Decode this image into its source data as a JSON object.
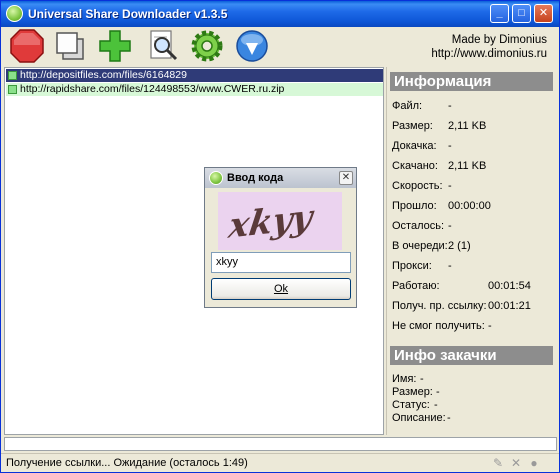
{
  "window": {
    "title": "Universal Share Downloader v1.3.5"
  },
  "title_buttons": {
    "minimize": "_",
    "maximize": "□",
    "close": "✕"
  },
  "toolbar": {
    "icons": [
      "stop-icon",
      "copy-icon",
      "add-icon",
      "search-icon",
      "gear-icon",
      "info-icon"
    ],
    "credits_line1": "Made by Dimonius",
    "credits_line2": "http://www.dimonius.ru"
  },
  "downloads": [
    {
      "url": "http://depositfiles.com/files/6164829",
      "selected": true
    },
    {
      "url": "http://rapidshare.com/files/124498553/www.CWER.ru.zip",
      "selected": false
    }
  ],
  "info": {
    "header": "Информация",
    "rows": [
      {
        "label": "Файл:",
        "value": "-"
      },
      {
        "label": "Размер:",
        "value": "2,11 KB"
      },
      {
        "label": "Докачка:",
        "value": "-"
      },
      {
        "label": "Скачано:",
        "value": "2,11 KB"
      },
      {
        "label": "Скорость:",
        "value": "-"
      },
      {
        "label": "Прошло:",
        "value": "00:00:00"
      },
      {
        "label": "Осталось:",
        "value": "-"
      },
      {
        "label": "В очереди:",
        "value": "2 (1)"
      },
      {
        "label": "Прокси:",
        "value": "-"
      },
      {
        "label": "Работаю:",
        "value": "00:01:54"
      },
      {
        "label": "Получ. пр. ссылку:",
        "value": "00:01:21"
      },
      {
        "label": "Не смог получить:",
        "value": "-"
      }
    ]
  },
  "download_info": {
    "header": "Инфо закачки",
    "rows": [
      {
        "label": "Имя:",
        "value": "-"
      },
      {
        "label": "Размер:",
        "value": "-"
      },
      {
        "label": "Статус:",
        "value": "-"
      },
      {
        "label": "Описание:",
        "value": "-"
      }
    ]
  },
  "dialog": {
    "title": "Ввод кода",
    "captcha_text": "xkyy",
    "input_value": "xkyy",
    "ok_label": "Ok"
  },
  "status": {
    "text": "Получение ссылки... Ожидание (осталось 1:49)",
    "icons": [
      "tool-icon",
      "connect-icon",
      "record-icon"
    ]
  },
  "colors": {
    "title_bar": "#0d55d6",
    "selected_row": "#2f3b78",
    "alt_row": "#d7f8d7",
    "section_header": "#8d8d8d"
  }
}
